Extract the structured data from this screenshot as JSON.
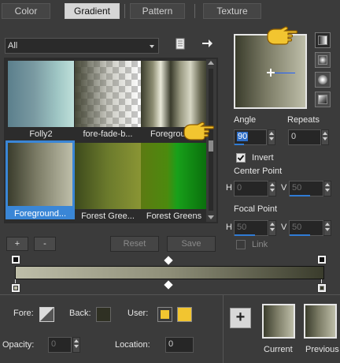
{
  "tabs": [
    {
      "label": "Color"
    },
    {
      "label": "Gradient"
    },
    {
      "label": "Pattern"
    },
    {
      "label": "Texture"
    }
  ],
  "filter": {
    "selected": "All"
  },
  "gradients": [
    {
      "name": "Folly2"
    },
    {
      "name": "fore-fade-b..."
    },
    {
      "name": "Foregroun..."
    },
    {
      "name": "Foreground..."
    },
    {
      "name": "Forest Gree..."
    },
    {
      "name": "Forest Greens"
    }
  ],
  "list_buttons": {
    "add": "+",
    "remove": "-",
    "reset": "Reset",
    "save": "Save"
  },
  "angle": {
    "label": "Angle",
    "value": "90"
  },
  "repeats": {
    "label": "Repeats",
    "value": "0"
  },
  "invert": {
    "label": "Invert",
    "checked": true
  },
  "center_point": {
    "label": "Center Point",
    "h_label": "H",
    "h_value": "0",
    "v_label": "V",
    "v_value": "50"
  },
  "focal_point": {
    "label": "Focal Point",
    "h_label": "H",
    "h_value": "50",
    "v_label": "V",
    "v_value": "50"
  },
  "link": {
    "label": "Link"
  },
  "bottom": {
    "fore_label": "Fore:",
    "back_label": "Back:",
    "user_label": "User:",
    "opacity_label": "Opacity:",
    "opacity_value": "0",
    "location_label": "Location:",
    "location_value": "0",
    "add_button": "+",
    "current_label": "Current",
    "previous_label": "Previous"
  },
  "colors": {
    "accent_blue": "#3a86d6",
    "user_yellow": "#f2c530",
    "back_dark": "#2f3023",
    "gradient_dark": "#3a3c2c",
    "gradient_light": "#bebea9"
  }
}
